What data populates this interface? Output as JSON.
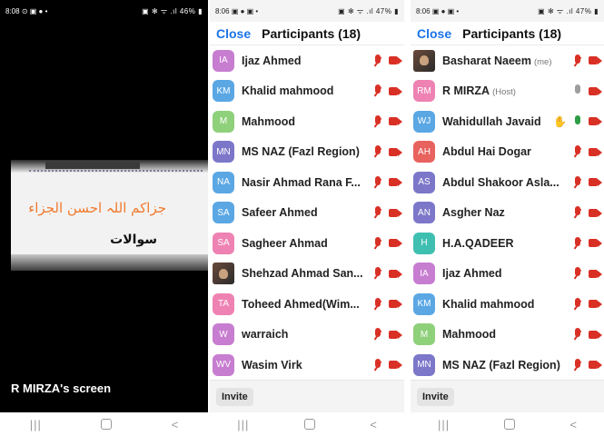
{
  "phone1": {
    "status": {
      "time": "8:08",
      "left_icons": "⊙ ▣ ● •",
      "right": "▣ ✻ ᯤ .ıl 46% ▮"
    },
    "share": {
      "urdu_line1": "جزاکم اللہ احسن الجزاء",
      "urdu_line2": "سوالات"
    },
    "screen_label": "R MIRZA's screen"
  },
  "phone2": {
    "status": {
      "time": "8:06",
      "left_icons": "▣ ● ▣ •",
      "right": "▣ ✻ ᯤ .ıl 47% ▮"
    },
    "close_label": "Close",
    "title": "Participants (18)",
    "participants": [
      {
        "initials": "IA",
        "name": "Ijaz Ahmed",
        "color": "#c77dd0",
        "mic": "muted",
        "cam": "off"
      },
      {
        "initials": "KM",
        "name": "Khalid mahmood",
        "color": "#5aa7e4",
        "mic": "muted",
        "cam": "off"
      },
      {
        "initials": "M",
        "name": "Mahmood",
        "color": "#8fd07b",
        "mic": "muted",
        "cam": "off"
      },
      {
        "initials": "MN",
        "name": "MS NAZ (Fazl Region)",
        "color": "#7c77c9",
        "mic": "muted",
        "cam": "off"
      },
      {
        "initials": "NA",
        "name": "Nasir Ahmad Rana F...",
        "color": "#5aa7e4",
        "mic": "muted",
        "cam": "off"
      },
      {
        "initials": "SA",
        "name": "Safeer Ahmed",
        "color": "#5aa7e4",
        "mic": "muted",
        "cam": "off"
      },
      {
        "initials": "SA",
        "name": "Sagheer Ahmad",
        "color": "#ee82b3",
        "mic": "muted",
        "cam": "off"
      },
      {
        "initials": "",
        "name": "Shehzad Ahmad San...",
        "color": "photo",
        "mic": "muted",
        "cam": "off"
      },
      {
        "initials": "TA",
        "name": "Toheed Ahmed(Wim...",
        "color": "#ee82b3",
        "mic": "muted",
        "cam": "off"
      },
      {
        "initials": "W",
        "name": "warraich",
        "color": "#c77dd0",
        "mic": "muted",
        "cam": "off"
      },
      {
        "initials": "WV",
        "name": "Wasim Virk",
        "color": "#c77dd0",
        "mic": "muted",
        "cam": "off"
      }
    ],
    "invite_label": "Invite"
  },
  "phone3": {
    "status": {
      "time": "8:06",
      "left_icons": "▣ ● ▣ •",
      "right": "▣ ✻ ᯤ .ıl 47% ▮"
    },
    "close_label": "Close",
    "title": "Participants (18)",
    "participants": [
      {
        "initials": "",
        "name": "Basharat Naeem",
        "role": "(me)",
        "color": "photo",
        "mic": "muted",
        "cam": "off"
      },
      {
        "initials": "RM",
        "name": "R MIRZA",
        "role": "(Host)",
        "color": "#ee82b3",
        "mic": "grey",
        "cam": "off"
      },
      {
        "initials": "WJ",
        "name": "Wahidullah Javaid",
        "color": "#5aa7e4",
        "mic": "green",
        "cam": "off",
        "hand": true
      },
      {
        "initials": "AH",
        "name": "Abdul Hai Dogar",
        "color": "#e8625e",
        "mic": "muted",
        "cam": "off"
      },
      {
        "initials": "AS",
        "name": "Abdul Shakoor Asla...",
        "color": "#7c77c9",
        "mic": "muted",
        "cam": "off"
      },
      {
        "initials": "AN",
        "name": "Asgher Naz",
        "color": "#7c77c9",
        "mic": "muted",
        "cam": "off"
      },
      {
        "initials": "H",
        "name": "H.A.QADEER",
        "color": "#3fbfb0",
        "mic": "muted",
        "cam": "off"
      },
      {
        "initials": "IA",
        "name": "Ijaz Ahmed",
        "color": "#c77dd0",
        "mic": "muted",
        "cam": "off"
      },
      {
        "initials": "KM",
        "name": "Khalid mahmood",
        "color": "#5aa7e4",
        "mic": "muted",
        "cam": "off"
      },
      {
        "initials": "M",
        "name": "Mahmood",
        "color": "#8fd07b",
        "mic": "muted",
        "cam": "off"
      },
      {
        "initials": "MN",
        "name": "MS NAZ (Fazl Region)",
        "color": "#7c77c9",
        "mic": "muted",
        "cam": "off"
      }
    ],
    "invite_label": "Invite"
  },
  "navbar": {
    "recent": "|||",
    "back": "<"
  }
}
